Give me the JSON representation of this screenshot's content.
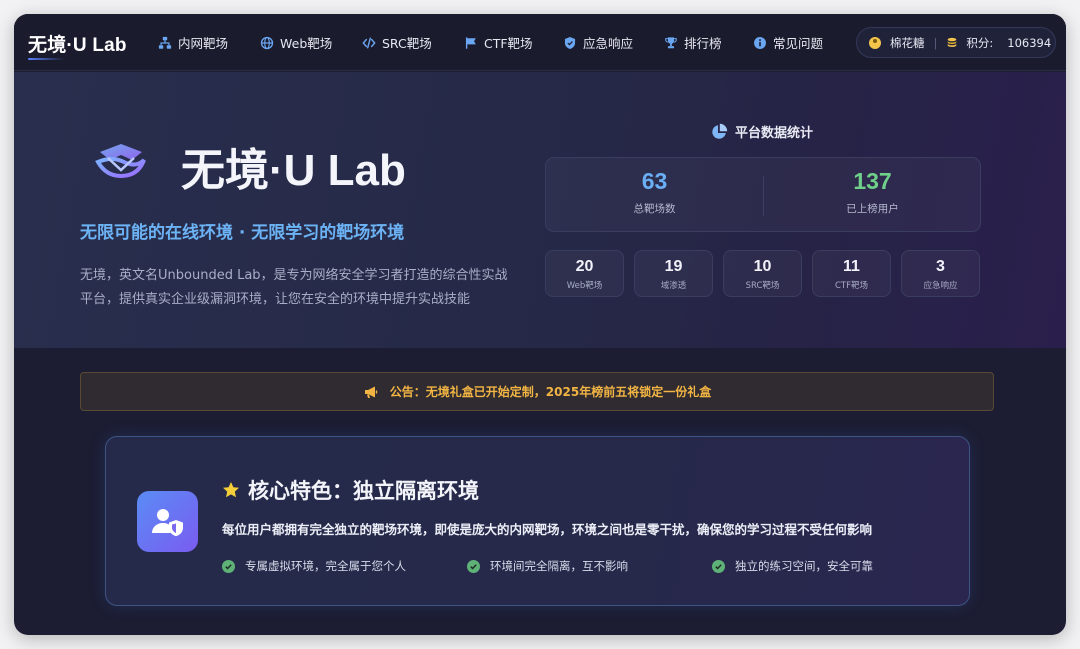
{
  "nav": {
    "brand": "无境·U Lab",
    "items": [
      {
        "label": "内网靶场",
        "icon": "network-icon"
      },
      {
        "label": "Web靶场",
        "icon": "globe-icon"
      },
      {
        "label": "SRC靶场",
        "icon": "code-icon"
      },
      {
        "label": "CTF靶场",
        "icon": "flag-icon"
      },
      {
        "label": "应急响应",
        "icon": "shield-icon"
      },
      {
        "label": "排行榜",
        "icon": "trophy-icon"
      },
      {
        "label": "常见问题",
        "icon": "info-icon"
      }
    ],
    "user": {
      "name": "棉花糖",
      "score_label": "积分:",
      "score": "106394"
    }
  },
  "hero": {
    "title": "无境·U Lab",
    "subtitle": "无限可能的在线环境 · 无限学习的靶场环境",
    "description": "无境，英文名Unbounded Lab，是专为网络安全学习者打造的综合性实战平台，提供真实企业级漏洞环境，让您在安全的环境中提升实战技能",
    "stats_title": "平台数据统计",
    "big_stats": [
      {
        "value": "63",
        "label": "总靶场数",
        "color": "#6aaef5"
      },
      {
        "value": "137",
        "label": "已上榜用户",
        "color": "#6fd08a"
      }
    ],
    "small_stats": [
      {
        "value": "20",
        "label": "Web靶场"
      },
      {
        "value": "19",
        "label": "域渗透"
      },
      {
        "value": "10",
        "label": "SRC靶场"
      },
      {
        "value": "11",
        "label": "CTF靶场"
      },
      {
        "value": "3",
        "label": "应急响应"
      }
    ]
  },
  "announcement": {
    "text": "公告：无境礼盒已开始定制，2025年榜前五将锁定一份礼盒",
    "icon": "megaphone-icon"
  },
  "feature": {
    "title": "核心特色：独立隔离环境",
    "description": "每位用户都拥有完全独立的靶场环境，即使是庞大的内网靶场，环境之间也是零干扰，确保您的学习过程不受任何影响",
    "points": [
      "专属虚拟环境，完全属于您个人",
      "环境间完全隔离，互不影响",
      "独立的练习空间，安全可靠"
    ]
  },
  "colors": {
    "accent": "#6cb3f5",
    "success": "#5fb277",
    "warning": "#f2b544"
  }
}
